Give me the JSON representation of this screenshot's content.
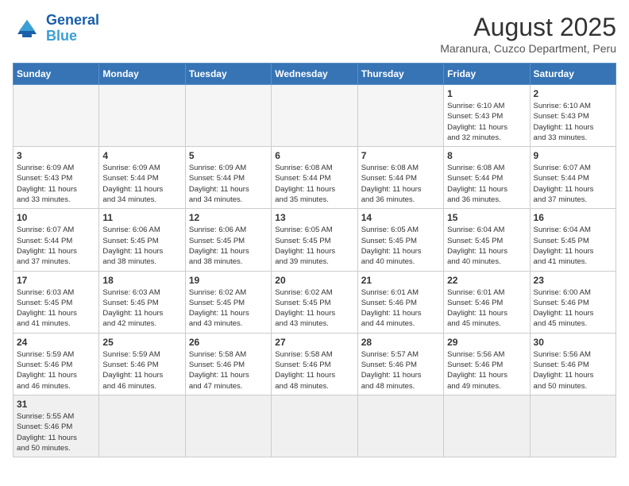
{
  "header": {
    "logo_general": "General",
    "logo_blue": "Blue",
    "month_year": "August 2025",
    "location": "Maranura, Cuzco Department, Peru"
  },
  "days_of_week": [
    "Sunday",
    "Monday",
    "Tuesday",
    "Wednesday",
    "Thursday",
    "Friday",
    "Saturday"
  ],
  "weeks": [
    [
      {
        "day": "",
        "info": ""
      },
      {
        "day": "",
        "info": ""
      },
      {
        "day": "",
        "info": ""
      },
      {
        "day": "",
        "info": ""
      },
      {
        "day": "",
        "info": ""
      },
      {
        "day": "1",
        "info": "Sunrise: 6:10 AM\nSunset: 5:43 PM\nDaylight: 11 hours\nand 32 minutes."
      },
      {
        "day": "2",
        "info": "Sunrise: 6:10 AM\nSunset: 5:43 PM\nDaylight: 11 hours\nand 33 minutes."
      }
    ],
    [
      {
        "day": "3",
        "info": "Sunrise: 6:09 AM\nSunset: 5:43 PM\nDaylight: 11 hours\nand 33 minutes."
      },
      {
        "day": "4",
        "info": "Sunrise: 6:09 AM\nSunset: 5:44 PM\nDaylight: 11 hours\nand 34 minutes."
      },
      {
        "day": "5",
        "info": "Sunrise: 6:09 AM\nSunset: 5:44 PM\nDaylight: 11 hours\nand 34 minutes."
      },
      {
        "day": "6",
        "info": "Sunrise: 6:08 AM\nSunset: 5:44 PM\nDaylight: 11 hours\nand 35 minutes."
      },
      {
        "day": "7",
        "info": "Sunrise: 6:08 AM\nSunset: 5:44 PM\nDaylight: 11 hours\nand 36 minutes."
      },
      {
        "day": "8",
        "info": "Sunrise: 6:08 AM\nSunset: 5:44 PM\nDaylight: 11 hours\nand 36 minutes."
      },
      {
        "day": "9",
        "info": "Sunrise: 6:07 AM\nSunset: 5:44 PM\nDaylight: 11 hours\nand 37 minutes."
      }
    ],
    [
      {
        "day": "10",
        "info": "Sunrise: 6:07 AM\nSunset: 5:44 PM\nDaylight: 11 hours\nand 37 minutes."
      },
      {
        "day": "11",
        "info": "Sunrise: 6:06 AM\nSunset: 5:45 PM\nDaylight: 11 hours\nand 38 minutes."
      },
      {
        "day": "12",
        "info": "Sunrise: 6:06 AM\nSunset: 5:45 PM\nDaylight: 11 hours\nand 38 minutes."
      },
      {
        "day": "13",
        "info": "Sunrise: 6:05 AM\nSunset: 5:45 PM\nDaylight: 11 hours\nand 39 minutes."
      },
      {
        "day": "14",
        "info": "Sunrise: 6:05 AM\nSunset: 5:45 PM\nDaylight: 11 hours\nand 40 minutes."
      },
      {
        "day": "15",
        "info": "Sunrise: 6:04 AM\nSunset: 5:45 PM\nDaylight: 11 hours\nand 40 minutes."
      },
      {
        "day": "16",
        "info": "Sunrise: 6:04 AM\nSunset: 5:45 PM\nDaylight: 11 hours\nand 41 minutes."
      }
    ],
    [
      {
        "day": "17",
        "info": "Sunrise: 6:03 AM\nSunset: 5:45 PM\nDaylight: 11 hours\nand 41 minutes."
      },
      {
        "day": "18",
        "info": "Sunrise: 6:03 AM\nSunset: 5:45 PM\nDaylight: 11 hours\nand 42 minutes."
      },
      {
        "day": "19",
        "info": "Sunrise: 6:02 AM\nSunset: 5:45 PM\nDaylight: 11 hours\nand 43 minutes."
      },
      {
        "day": "20",
        "info": "Sunrise: 6:02 AM\nSunset: 5:45 PM\nDaylight: 11 hours\nand 43 minutes."
      },
      {
        "day": "21",
        "info": "Sunrise: 6:01 AM\nSunset: 5:46 PM\nDaylight: 11 hours\nand 44 minutes."
      },
      {
        "day": "22",
        "info": "Sunrise: 6:01 AM\nSunset: 5:46 PM\nDaylight: 11 hours\nand 45 minutes."
      },
      {
        "day": "23",
        "info": "Sunrise: 6:00 AM\nSunset: 5:46 PM\nDaylight: 11 hours\nand 45 minutes."
      }
    ],
    [
      {
        "day": "24",
        "info": "Sunrise: 5:59 AM\nSunset: 5:46 PM\nDaylight: 11 hours\nand 46 minutes."
      },
      {
        "day": "25",
        "info": "Sunrise: 5:59 AM\nSunset: 5:46 PM\nDaylight: 11 hours\nand 46 minutes."
      },
      {
        "day": "26",
        "info": "Sunrise: 5:58 AM\nSunset: 5:46 PM\nDaylight: 11 hours\nand 47 minutes."
      },
      {
        "day": "27",
        "info": "Sunrise: 5:58 AM\nSunset: 5:46 PM\nDaylight: 11 hours\nand 48 minutes."
      },
      {
        "day": "28",
        "info": "Sunrise: 5:57 AM\nSunset: 5:46 PM\nDaylight: 11 hours\nand 48 minutes."
      },
      {
        "day": "29",
        "info": "Sunrise: 5:56 AM\nSunset: 5:46 PM\nDaylight: 11 hours\nand 49 minutes."
      },
      {
        "day": "30",
        "info": "Sunrise: 5:56 AM\nSunset: 5:46 PM\nDaylight: 11 hours\nand 50 minutes."
      }
    ],
    [
      {
        "day": "31",
        "info": "Sunrise: 5:55 AM\nSunset: 5:46 PM\nDaylight: 11 hours\nand 50 minutes."
      },
      {
        "day": "",
        "info": ""
      },
      {
        "day": "",
        "info": ""
      },
      {
        "day": "",
        "info": ""
      },
      {
        "day": "",
        "info": ""
      },
      {
        "day": "",
        "info": ""
      },
      {
        "day": "",
        "info": ""
      }
    ]
  ]
}
